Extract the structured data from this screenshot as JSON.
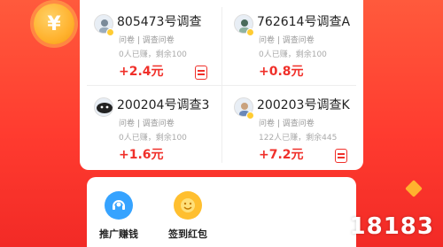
{
  "coin_symbol": "¥",
  "cards": [
    {
      "title": "805473号调查",
      "sub": "问卷 | 调查问卷",
      "stats": "0人已赚，剩余100",
      "reward": "+2.4元",
      "avatar_icon": "user-avatar-icon"
    },
    {
      "title": "762614号调查A",
      "sub": "问卷 | 调查问卷",
      "stats": "0人已赚，剩余100",
      "reward": "+0.8元",
      "avatar_icon": "user-avatar-icon"
    },
    {
      "title": "200204号调查3",
      "sub": "问卷 | 调查问卷",
      "stats": "0人已赚，剩余100",
      "reward": "+1.6元",
      "avatar_icon": "user-avatar-icon"
    },
    {
      "title": "200203号调查K",
      "sub": "问卷 | 调查问卷",
      "stats": "122人已赚，剩余445",
      "reward": "+7.2元",
      "avatar_icon": "user-avatar-icon"
    }
  ],
  "features": [
    {
      "label": "推广赚钱",
      "icon": "headset-icon",
      "color": "#36a3ff"
    },
    {
      "label": "签到红包",
      "icon": "smiley-icon",
      "color": "#ffbf2f"
    }
  ],
  "watermark": "18183",
  "colors": {
    "brand": "#f0302a",
    "accent": "#ffb22e"
  }
}
